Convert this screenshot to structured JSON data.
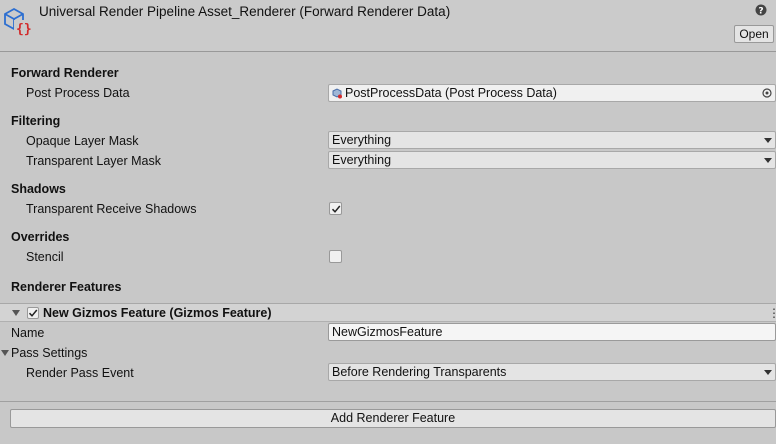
{
  "header": {
    "title": "Universal Render Pipeline Asset_Renderer (Forward Renderer Data)",
    "open_label": "Open",
    "asset_icon": "scriptable-object-icon",
    "help_icon": "help-icon",
    "menu_icon": "kebab-menu-icon"
  },
  "forward_renderer": {
    "heading": "Forward Renderer",
    "post_process_label": "Post Process Data",
    "post_process_value": "PostProcessData (Post Process Data)"
  },
  "filtering": {
    "heading": "Filtering",
    "opaque_label": "Opaque Layer Mask",
    "opaque_value": "Everything",
    "transparent_label": "Transparent Layer Mask",
    "transparent_value": "Everything"
  },
  "shadows": {
    "heading": "Shadows",
    "receive_label": "Transparent Receive Shadows",
    "receive_checked": true
  },
  "overrides": {
    "heading": "Overrides",
    "stencil_label": "Stencil",
    "stencil_checked": false
  },
  "renderer_features": {
    "heading": "Renderer Features",
    "feature": {
      "title": "New Gizmos Feature (Gizmos Feature)",
      "enabled": true,
      "expanded": true,
      "name_label": "Name",
      "name_value": "NewGizmosFeature",
      "pass_settings_label": "Pass Settings",
      "render_pass_event_label": "Render Pass Event",
      "render_pass_event_value": "Before Rendering Transparents"
    },
    "add_button": "Add Renderer Feature"
  },
  "colors": {
    "background": "#c8c8c8",
    "field": "#e4e4e4",
    "asset_icon_blue": "#2d6fd1",
    "asset_icon_red": "#d22b2b"
  }
}
